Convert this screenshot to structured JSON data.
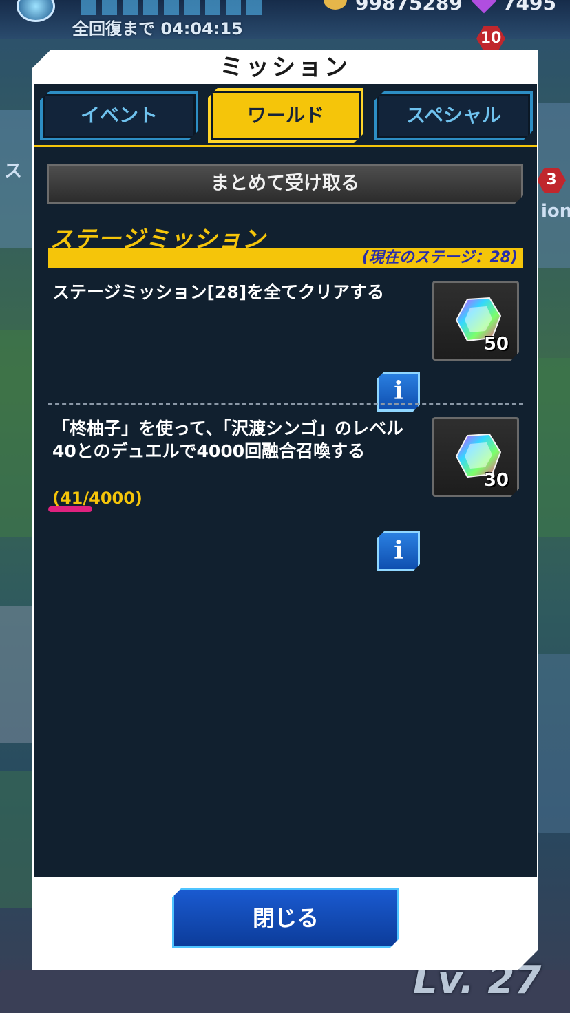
{
  "background": {
    "recovery_timer": "全回復まで 04:04:15",
    "coins": "99875289",
    "gems": "7495",
    "badge_top": "10",
    "badge_side": "3",
    "side_text_left": "ス",
    "side_text_right": "ion",
    "level": "Lv. 27"
  },
  "modal": {
    "title": "ミッション",
    "tabs": [
      {
        "label": "イベント",
        "active": false
      },
      {
        "label": "ワールド",
        "active": true
      },
      {
        "label": "スペシャル",
        "active": false
      }
    ],
    "receive_all_label": "まとめて受け取る",
    "section": {
      "title": "ステージミッション",
      "current_stage": "(現在のステージ：28)"
    },
    "missions": [
      {
        "text": "ステージミッション[28]を全てクリアする",
        "progress": "",
        "reward_count": "50",
        "reward_icon": "rainbow-gem-icon"
      },
      {
        "text": "「柊柚子」を使って、「沢渡シンゴ」のレベル40とのデュエルで4000回融合召喚する",
        "progress": "(41/4000)",
        "reward_count": "30",
        "reward_icon": "rainbow-gem-icon"
      }
    ],
    "info_label": "i",
    "close_label": "閉じる"
  },
  "colors": {
    "accent_yellow": "#f5c50a",
    "panel_dark": "#11202f",
    "tab_blue": "#2d8ec4",
    "highlight_pink": "#e0227f",
    "button_blue": "#1a5ad0"
  }
}
